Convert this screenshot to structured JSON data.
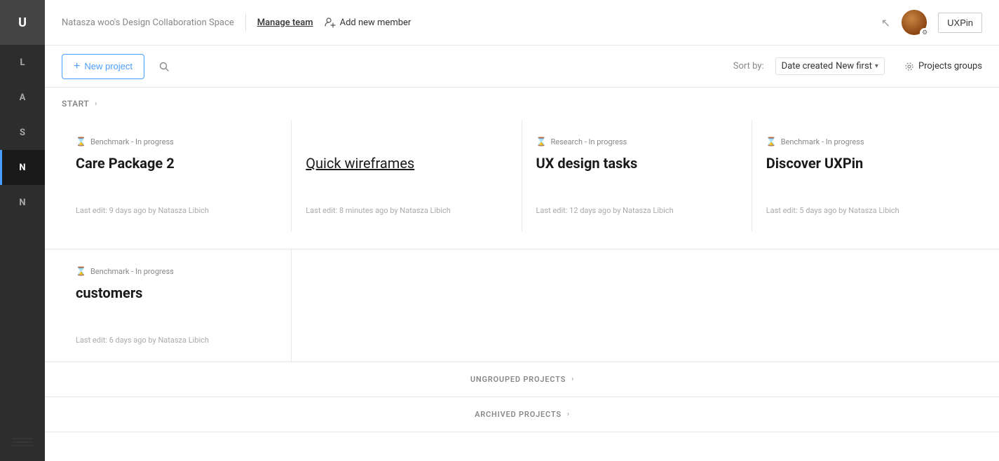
{
  "sidebar": {
    "items": [
      {
        "id": "U",
        "label": "U",
        "active": false
      },
      {
        "id": "L",
        "label": "L",
        "active": false
      },
      {
        "id": "A",
        "label": "A",
        "active": false
      },
      {
        "id": "S",
        "label": "S",
        "active": false
      },
      {
        "id": "N1",
        "label": "N",
        "active": true
      },
      {
        "id": "N2",
        "label": "N",
        "active": false
      }
    ]
  },
  "header": {
    "workspace": "Natasza woo's Design Collaboration Space",
    "manage_team": "Manage team",
    "add_member": "Add new member",
    "uxpin_btn": "UXPin"
  },
  "toolbar": {
    "new_project_plus": "+",
    "new_project_label": "New project",
    "sort_label": "Sort by:",
    "sort_value": "Date created",
    "sort_option": "New first",
    "projects_groups_label": "Projects groups"
  },
  "start_section": {
    "title": "START",
    "chevron": "›"
  },
  "projects": [
    {
      "status_icon": "⌛",
      "status": "Benchmark - In progress",
      "name": "Care Package 2",
      "underlined": false,
      "last_edit": "Last edit: 9 days ago by Natasza Libich"
    },
    {
      "status_icon": "",
      "status": "",
      "name": "Quick wireframes",
      "underlined": true,
      "last_edit": "Last edit: 8 minutes ago by Natasza Libich"
    },
    {
      "status_icon": "⌛",
      "status": "Research - In progress",
      "name": "UX design tasks",
      "underlined": false,
      "last_edit": "Last edit: 12 days ago by Natasza Libich"
    },
    {
      "status_icon": "⌛",
      "status": "Benchmark - In progress",
      "name": "Discover UXPin",
      "underlined": false,
      "last_edit": "Last edit: 5 days ago by Natasza Libich"
    }
  ],
  "project_customers": {
    "status_icon": "⌛",
    "status": "Benchmark - In progress",
    "name": "customers",
    "last_edit": "Last edit: 6 days ago by Natasza Libich"
  },
  "ungrouped": {
    "label": "UNGROUPED PROJECTS",
    "chevron": "›"
  },
  "archived": {
    "label": "ARCHIVED PROJECTS",
    "chevron": "›"
  }
}
